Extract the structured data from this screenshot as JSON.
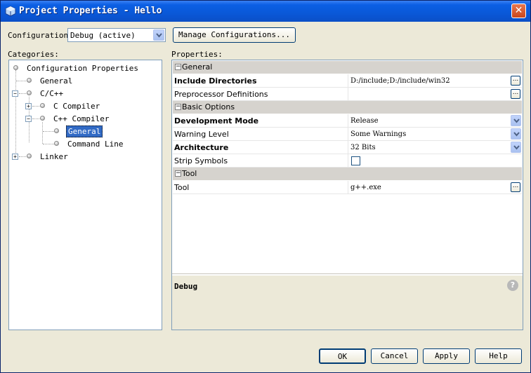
{
  "window": {
    "title": "Project Properties - Hello",
    "close_glyph": "✕"
  },
  "config": {
    "label": "Configuration:",
    "value": "Debug (active)",
    "manage_label": "Manage Configurations..."
  },
  "categories": {
    "label": "Categories:",
    "items": [
      "Configuration Properties",
      "General",
      "C/C++",
      "C Compiler",
      "C++ Compiler",
      "General",
      "Command Line",
      "Linker"
    ]
  },
  "properties": {
    "label": "Properties:",
    "sections": [
      "General",
      "Basic Options",
      "Tool"
    ],
    "rows": [
      {
        "name": "Include Directories",
        "value": "D:/include;D:/include/win32"
      },
      {
        "name": "Preprocessor Definitions",
        "value": ""
      },
      {
        "name": "Development Mode",
        "value": "Release"
      },
      {
        "name": "Warning Level",
        "value": "Some Warnings"
      },
      {
        "name": "Architecture",
        "value": "32 Bits"
      },
      {
        "name": "Strip Symbols",
        "value": ""
      },
      {
        "name": "Tool",
        "value": "g++.exe"
      }
    ],
    "ellipsis": "..."
  },
  "description": {
    "title": "Debug",
    "help_glyph": "?"
  },
  "buttons": {
    "ok": "OK",
    "cancel": "Cancel",
    "apply": "Apply",
    "help": "Help"
  },
  "icons": {
    "window_icon": "netbeans-cube-icon",
    "dropdown": "chevron-down-icon",
    "expand": "tree-expand-icon",
    "collapse": "tree-collapse-icon",
    "node": "tree-node-bullet-icon"
  },
  "colors": {
    "titlebar": "#0a58d8",
    "selection": "#316ac5",
    "dialog_bg": "#ece9d8"
  }
}
